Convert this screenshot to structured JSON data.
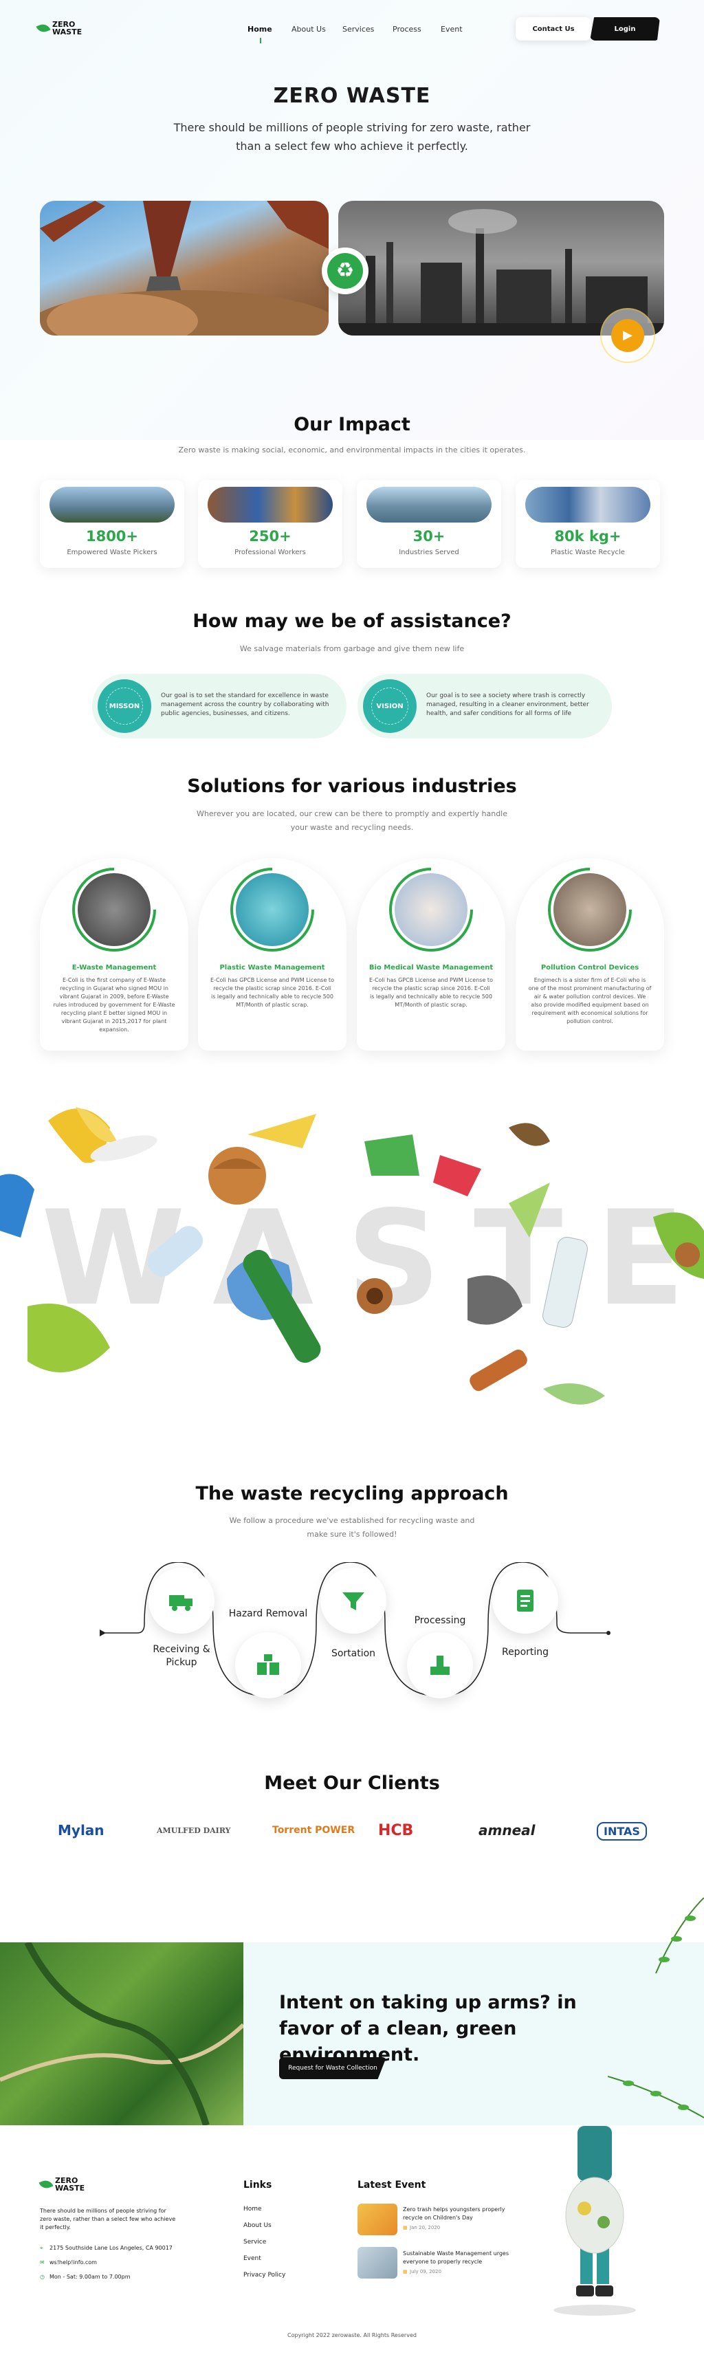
{
  "nav": {
    "logo": [
      "ZERO",
      "WASTE"
    ],
    "links": [
      "Home",
      "About Us",
      "Services",
      "Process",
      "Event"
    ],
    "contact": "Contact Us",
    "login": "Login"
  },
  "hero": {
    "title": "ZERO WASTE",
    "subtitle": "There should be millions of people striving for zero waste, rather than a select few who achieve it perfectly."
  },
  "impact": {
    "title": "Our Impact",
    "subtitle": "Zero waste is making social, economic, and environmental impacts in the cities it operates.",
    "stats": [
      {
        "value": "1800+",
        "label": "Empowered Waste Pickers"
      },
      {
        "value": "250+",
        "label": "Professional Workers"
      },
      {
        "value": "30+",
        "label": "Industries Served"
      },
      {
        "value": "80k kg+",
        "label": "Plastic Waste Recycle"
      }
    ]
  },
  "assist": {
    "title": "How may we be of assistance?",
    "subtitle": "We salvage materials from garbage and give them new life",
    "mission": {
      "badge": "MISSON",
      "text": "Our goal is to set the standard for excellence in waste management across the country by collaborating with public agencies, businesses, and citizens."
    },
    "vision": {
      "badge": "VISION",
      "text": "Our goal is to see a society where trash is correctly managed, resulting in a cleaner environment, better health, and safer conditions for all forms of life"
    }
  },
  "solutions": {
    "title": "Solutions for various industries",
    "subtitle": "Wherever you are located, our crew can be there to promptly and expertly handle your waste and recycling needs.",
    "items": [
      {
        "title": "E-Waste Management",
        "text": "E-Coli is the first company of E-Waste recycling in Gujarat who signed MOU in vibrant Gujarat in 2009, before E-Waste rules introduced by government for E-Waste recycling plant E better signed MOU in vibrant Gujarat in 2015,2017 for plant expansion."
      },
      {
        "title": "Plastic Waste Management",
        "text": "E-Coli has GPCB License and PWM License to recycle the plastic scrap since 2016. E-Coli is legally and technically able to recycle 500 MT/Month of plastic scrap."
      },
      {
        "title": "Bio Medical Waste Management",
        "text": "E-Coli has GPCB License and PWM License to recycle the plastic scrap since 2016. E-Coli is legally and technically able to recycle 500 MT/Month of plastic scrap."
      },
      {
        "title": "Pollution Control Devices",
        "text": "Engimech is a sister firm of E-Coli who is one of the most prominent manufacturing of air & water pollution control devices. We also provide modified equipment based on requirement with economical solutions for pollution control."
      }
    ]
  },
  "waste_word": "WASTE",
  "approach": {
    "title": "The waste recycling approach",
    "subtitle": "We follow a procedure we've established for recycling waste and make sure it's followed!",
    "steps": [
      "Receiving & Pickup",
      "Hazard Removal",
      "Sortation",
      "Processing",
      "Reporting"
    ]
  },
  "clients": {
    "title": "Meet Our Clients",
    "logos": [
      "Mylan",
      "AMULFED DAIRY",
      "Torrent POWER",
      "HCB",
      "amneal",
      "INTAS"
    ]
  },
  "cta": {
    "headline": "Intent on taking up arms? in favor of a clean, green environment.",
    "button": "Request for Waste Collection"
  },
  "footer": {
    "logo": [
      "ZERO",
      "WASTE"
    ],
    "about": "There should be millions of people striving for zero waste, rather than a select few who achieve it perfectly.",
    "address": "2175 Southside Lane Los Angeles, CA 90017",
    "email": "ws!help!info.com",
    "hours": "Mon - Sat: 9.00am to 7.00pm",
    "links_title": "Links",
    "links": [
      "Home",
      "About Us",
      "Service",
      "Event",
      "Privacy Policy"
    ],
    "events_title": "Latest Event",
    "events": [
      {
        "title": "Zero trash helps youngsters properly recycle on Children's Day",
        "date": "Jan 20, 2020"
      },
      {
        "title": "Sustainable Waste Management urges everyone to properly recycle",
        "date": "July 09, 2020"
      }
    ],
    "copyright": "Copyright 2022 zerowaste. All Rights Reserved"
  },
  "colors": {
    "accent": "#2ca84a",
    "dark": "#111111",
    "mint": "#e9f7f1"
  }
}
